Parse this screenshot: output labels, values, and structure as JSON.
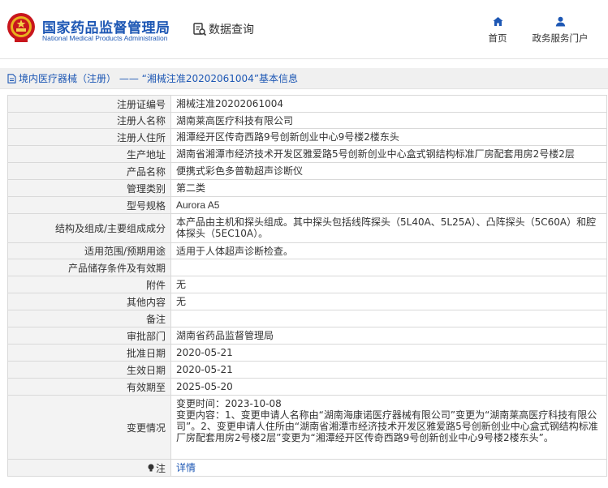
{
  "header": {
    "logo_cn": "国家药品监督管理局",
    "logo_en": "National Medical Products Administration",
    "query_label": "数据查询",
    "nav": [
      {
        "label": "首页",
        "icon": "home-icon"
      },
      {
        "label": "政务服务门户",
        "icon": "user-icon"
      }
    ]
  },
  "breadcrumb": {
    "text": "境内医疗器械（注册） —— “湘械注准20202061004”基本信息"
  },
  "table": {
    "rows": [
      {
        "label": "注册证编号",
        "value": "湘械注准20202061004"
      },
      {
        "label": "注册人名称",
        "value": "湖南莱高医疗科技有限公司"
      },
      {
        "label": "注册人住所",
        "value": "湘潭经开区传奇西路9号创新创业中心9号楼2楼东头"
      },
      {
        "label": "生产地址",
        "value": "湖南省湘潭市经济技术开发区雅爱路5号创新创业中心盒式钢结构标准厂房配套用房2号楼2层"
      },
      {
        "label": "产品名称",
        "value": "便携式彩色多普勒超声诊断仪"
      },
      {
        "label": "管理类别",
        "value": "第二类"
      },
      {
        "label": "型号规格",
        "value": "Aurora A5"
      },
      {
        "label": "结构及组成/主要组成成分",
        "value": "本产品由主机和探头组成。其中探头包括线阵探头（5L40A、5L25A）、凸阵探头（5C60A）和腔体探头（5EC10A）。"
      },
      {
        "label": "适用范围/预期用途",
        "value": "适用于人体超声诊断检查。"
      },
      {
        "label": "产品储存条件及有效期",
        "value": ""
      },
      {
        "label": "附件",
        "value": "无"
      },
      {
        "label": "其他内容",
        "value": "无"
      },
      {
        "label": "备注",
        "value": ""
      },
      {
        "label": "审批部门",
        "value": "湖南省药品监督管理局"
      },
      {
        "label": "批准日期",
        "value": "2020-05-21"
      },
      {
        "label": "生效日期",
        "value": "2020-05-21"
      },
      {
        "label": "有效期至",
        "value": "2025-05-20"
      },
      {
        "label": "变更情况",
        "value": "变更时间：2023-10-08\n变更内容：1、变更申请人名称由“湖南海康诺医疗器械有限公司”变更为“湖南莱高医疗科技有限公司”。2、变更申请人住所由“湖南省湘潭市经济技术开发区雅爱路5号创新创业中心盒式钢结构标准厂房配套用房2号楼2层”变更为“湘潭经开区传奇西路9号创新创业中心9号楼2楼东头”。"
      },
      {
        "label": "注",
        "value": "详情"
      }
    ]
  }
}
